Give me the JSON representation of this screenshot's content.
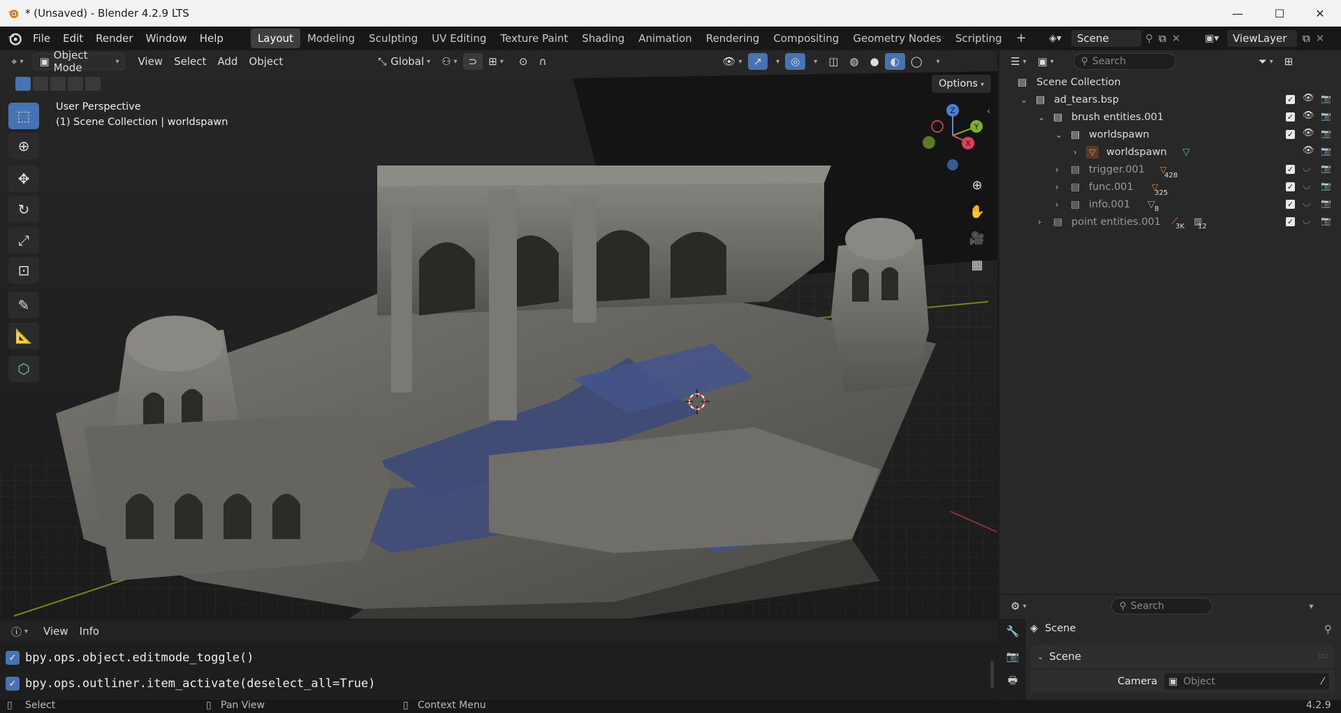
{
  "window": {
    "title": "* (Unsaved) - Blender 4.2.9 LTS",
    "minimize": "—",
    "maximize": "☐",
    "close": "✕"
  },
  "menu": [
    "File",
    "Edit",
    "Render",
    "Window",
    "Help"
  ],
  "workspaces": [
    "Layout",
    "Modeling",
    "Sculpting",
    "UV Editing",
    "Texture Paint",
    "Shading",
    "Animation",
    "Rendering",
    "Compositing",
    "Geometry Nodes",
    "Scripting"
  ],
  "add_workspace": "+",
  "scene_selector": {
    "name": "Scene",
    "view_layer": "ViewLayer"
  },
  "viewport": {
    "mode": "Object Mode",
    "menus": [
      "View",
      "Select",
      "Add",
      "Object"
    ],
    "transform_orientation": "Global",
    "options": "Options",
    "overlay_title": "User Perspective",
    "overlay_sub": "(1) Scene Collection | worldspawn",
    "gizmo": {
      "z": "Z",
      "y": "Y",
      "x": "X"
    }
  },
  "outliner": {
    "search_placeholder": "Search",
    "root": "Scene Collection",
    "rows": [
      {
        "label": "ad_tears.bsp",
        "depth": 0
      },
      {
        "label": "brush entities.001",
        "depth": 1
      },
      {
        "label": "worldspawn",
        "depth": 2
      },
      {
        "label": "worldspawn",
        "depth": 3
      },
      {
        "label": "trigger.001",
        "depth": 2,
        "count": "428"
      },
      {
        "label": "func.001",
        "depth": 2,
        "count": "325"
      },
      {
        "label": "info.001",
        "depth": 2,
        "count": "8"
      },
      {
        "label": "point entities.001",
        "depth": 1,
        "count": "3K",
        "count2": "12"
      }
    ]
  },
  "properties": {
    "search_placeholder": "Search",
    "context": "Scene",
    "panel": "Scene",
    "camera_label": "Camera",
    "camera_placeholder": "Object"
  },
  "info_editor": {
    "menus": [
      "View",
      "Info"
    ],
    "log": [
      "bpy.ops.object.editmode_toggle()",
      "bpy.ops.outliner.item_activate(deselect_all=True)"
    ]
  },
  "statusbar": {
    "select": "Select",
    "pan": "Pan View",
    "context": "Context Menu",
    "version": "4.2.9"
  }
}
